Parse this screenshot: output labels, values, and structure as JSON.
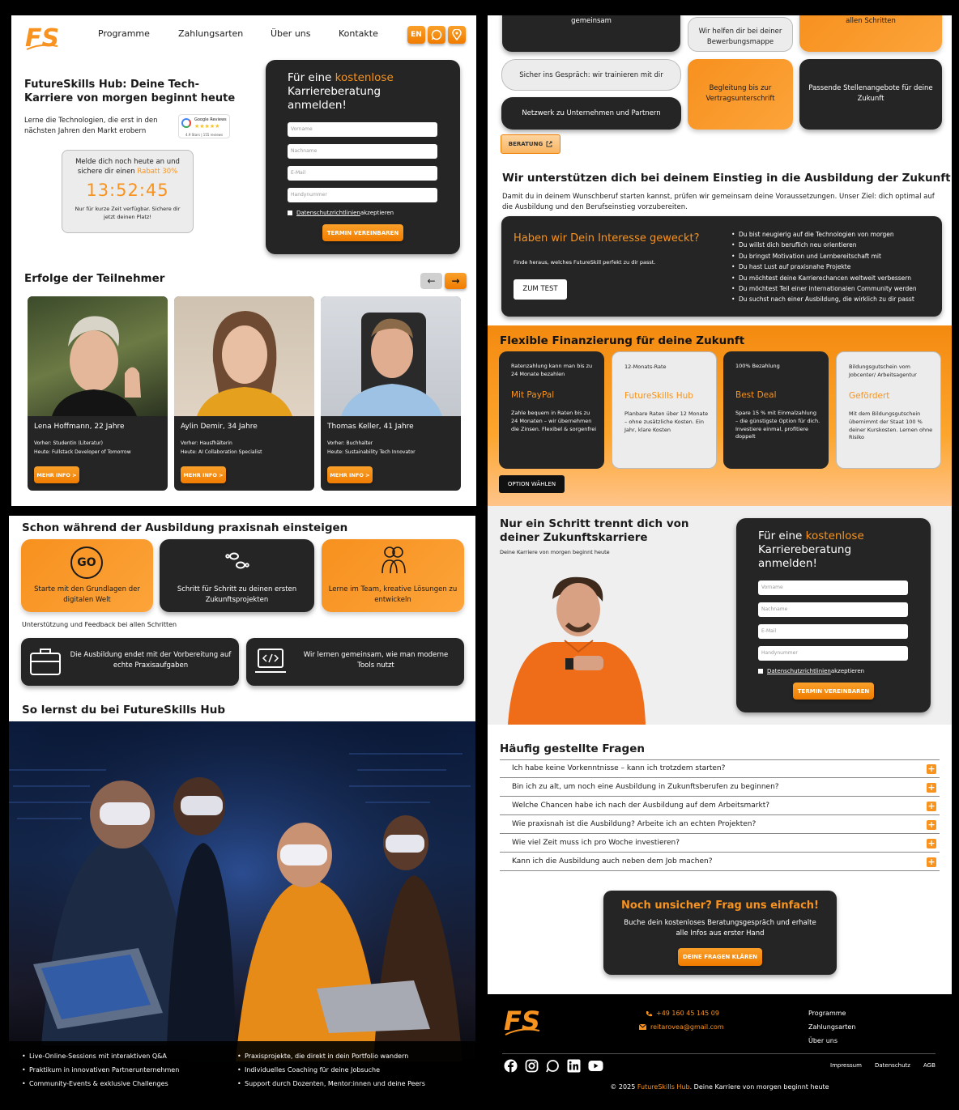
{
  "brand": {
    "logo": "FS",
    "name": "FutureSkills Hub",
    "orange": "#f7931e",
    "dark": "#252525"
  },
  "nav": {
    "items": [
      "Programme",
      "Zahlungsarten",
      "Über uns",
      "Kontakte"
    ],
    "lang": "EN"
  },
  "hero": {
    "title": "FutureSkills Hub: Deine Tech-Karriere von morgen beginnt heute",
    "subtitle": "Lerne die Technologien, die erst in den nächsten Jahren den Markt erobern",
    "google": "Google Reviews",
    "stars": "★★★★★",
    "rating_text": "4.9 Stars | 155 reviews"
  },
  "promo": {
    "line1": "Melde dich noch heute an und",
    "line2_pre": "sichere dir einen ",
    "line2_hl": "Rabatt 30%",
    "timer": "13:52:45",
    "note": "Nur für kurze Zeit verfügbar. Sichere dir jetzt deinen Platz!"
  },
  "form": {
    "title_pre": "Für eine ",
    "title_hl": "kostenlose",
    "title_post": "Karriereberatung anmelden!",
    "fields": [
      "Vorname",
      "Nachname",
      "E-Mail",
      "Handynummer"
    ],
    "privacy": "Datenschutzrichtlinien",
    "privacy_post": " akzeptieren",
    "button": "TERMIN VEREINBAREN"
  },
  "success": {
    "title": "Erfolge der Teilnehmer",
    "prev": "←",
    "next": "→",
    "people": [
      {
        "name": "Lena Hoffmann, 22 Jahre",
        "before": "Vorher: Studentin (Literatur)",
        "now": "Heute: Fullstack Developer of Tomorrow",
        "btn": "MEHR INFO >"
      },
      {
        "name": "Aylin Demir, 34 Jahre",
        "before": "Vorher: Hausfhälterin",
        "now": "Heute: AI Collaboration Specialist",
        "btn": "MEHR INFO >"
      },
      {
        "name": "Thomas Keller, 41 Jahre",
        "before": "Vorher: Buchhalter",
        "now": "Heute: Sustainability Tech Innovator",
        "btn": "MEHR INFO >"
      }
    ]
  },
  "support": {
    "b1": "gemeinsam",
    "b2": "Wir helfen dir bei deiner Bewerbungsmappe",
    "b3": "allen Schritten",
    "b4": "Sicher ins Gespräch: wir trainieren mit dir",
    "b5": "Begleitung bis zur Vertragsunterschrift",
    "b6": "Passende Stellenangebote für deine Zukunft",
    "b7": "Netzwerk zu Unternehmen und Partnern",
    "btn": "BERATUNG"
  },
  "einstieg": {
    "title": "Wir unterstützen dich bei deinem Einstieg in die Ausbildung der Zukunft",
    "text": "Damit du in deinem Wunschberuf starten kannst, prüfen wir gemeinsam deine Voraussetzungen. Unser Ziel: dich optimal auf die Ausbildung und den Berufseinstieg vorzubereiten.",
    "box_title": "Haben wir Dein Interesse geweckt?",
    "box_text": "Finde heraus, welches FutureSkill perfekt zu dir passt.",
    "box_btn": "ZUM TEST",
    "bullets": [
      "Du bist neugierig auf die Technologien von morgen",
      "Du willst dich beruflich neu orientieren",
      "Du bringst Motivation und Lernbereitschaft mit",
      "Du hast Lust auf praxisnahe Projekte",
      "Du möchtest deine Karrierechancen weltweit verbessern",
      "Du möchtest Teil einer internationalen Community werden",
      "Du suchst nach einer Ausbildung, die wirklich zu dir passt"
    ]
  },
  "finance": {
    "title": "Flexible Finanzierung für deine Zukunft",
    "btn": "OPTION WÄHLEN",
    "cards": [
      {
        "top": "Ratenzahlung kann man bis zu 24 Monate bezahlen",
        "head": "Mit PayPal",
        "body": "Zahle bequem in Raten bis zu 24 Monaten – wir übernehmen die Zinsen. Flexibel & sorgenfrei"
      },
      {
        "top": "12-Monats-Rate",
        "head": "FutureSkills Hub",
        "body": "Planbare Raten über 12 Monate – ohne zusätzliche Kosten. Ein Jahr, klare Kosten"
      },
      {
        "top": "100% Bezahlung",
        "head": "Best Deal",
        "body": "Spare 15 % mit Einmalzahlung – die günstigste Option für dich. Investiere einmal, profitiere doppelt"
      },
      {
        "top": "Bildungsgutschein vom Jobcenter/ Arbeitsagentur",
        "head": "Gefördert",
        "body": "Mit dem Bildungsgutschein übernimmt der Staat 100 % deiner Kurskosten. Lernen ohne Risiko"
      }
    ]
  },
  "cta2": {
    "title": "Nur ein Schritt trennt dich von deiner Zukunftskarriere",
    "sub": "Deine Karriere von morgen beginnt heute"
  },
  "faq": {
    "title": "Häufig gestellte Fragen",
    "items": [
      "Ich habe keine Vorkenntnisse – kann ich trotzdem starten?",
      "Bin ich zu alt, um noch eine Ausbildung in Zukunftsberufen zu beginnen?",
      "Welche Chancen habe ich nach der Ausbildung auf dem Arbeitsmarkt?",
      "Wie praxisnah ist die Ausbildung? Arbeite ich an echten Projekten?",
      "Wie viel Zeit muss ich pro Woche investieren?",
      "Kann ich die Ausbildung auch neben dem Job machen?"
    ]
  },
  "ask": {
    "title": "Noch unsicher? Frag uns einfach!",
    "text": "Buche dein kostenloses Beratungsgespräch und erhalte alle Infos aus erster Hand",
    "btn": "DEINE FRAGEN KLÄREN"
  },
  "praxis": {
    "title": "Schon während der Ausbildung praxisnah einsteigen",
    "go": "GO",
    "c1": "Starte mit den Grundlagen der digitalen Welt",
    "c2": "Schritt für Schritt zu deinen ersten Zukunftsprojekten",
    "c3": "Lerne im Team, kreative Lösungen zu entwickeln",
    "note": "Unterstützung und Feedback bei allen Schritten",
    "c4": "Die Ausbildung endet mit der Vorbereitung auf echte Praxisaufgaben",
    "c5": "Wir lernen gemeinsam, wie man moderne Tools nutzt"
  },
  "learn": {
    "title": "So lernst du bei FutureSkills Hub",
    "left": [
      "Live-Online-Sessions mit interaktiven Q&A",
      "Praktikum in innovativen Partnerunternehmen",
      "Community-Events & exklusive Challenges"
    ],
    "right": [
      "Praxisprojekte, die direkt in dein Portfolio wandern",
      "Individuelles Coaching für deine Jobsuche",
      "Support durch Dozenten, Mentor:innen und deine Peers"
    ]
  },
  "footer": {
    "phone": "+49 160 45 145 09",
    "email": "reitarovea@gmail.com",
    "links": [
      "Programme",
      "Zahlungsarten",
      "Über uns"
    ],
    "legal": [
      "Impressum",
      "Datenschutz",
      "AGB"
    ],
    "copy_pre": "© 2025 ",
    "copy_brand": "FutureSkills Hub",
    "copy_post": ". Deine Karriere von morgen beginnt heute"
  }
}
